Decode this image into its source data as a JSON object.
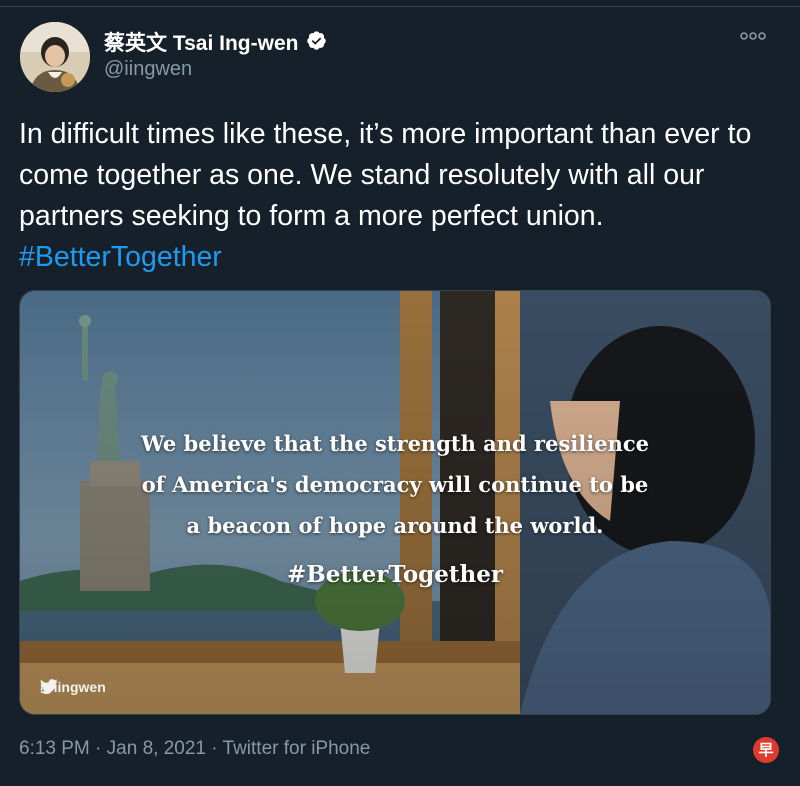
{
  "author": {
    "name": "蔡英文 Tsai Ing-wen",
    "handle": "@iingwen",
    "verified_icon": "verified-badge-icon"
  },
  "more_icon": "more-options-icon",
  "tweet": {
    "text": "In difficult times like these, it’s more important than ever to come together as one. We stand resolutely with all our partners seeking to form a more perfect union.",
    "hashtag": "#BetterTogether"
  },
  "media": {
    "quote_lines": [
      "We believe that the strength and resilience",
      "of America's democracy will continue to be",
      "a beacon of hope around the world.",
      "#BetterTogether"
    ],
    "watermark_handle": "@iingwen"
  },
  "meta": {
    "time": "6:13 PM",
    "date": "Jan 8, 2021",
    "source": "Twitter for iPhone",
    "separator": " · "
  },
  "corner_logo_text": "早",
  "colors": {
    "background": "#15202b",
    "text": "#ffffff",
    "secondary": "#8899a6",
    "link": "#1d9bf0",
    "verified": "#ffffff"
  }
}
